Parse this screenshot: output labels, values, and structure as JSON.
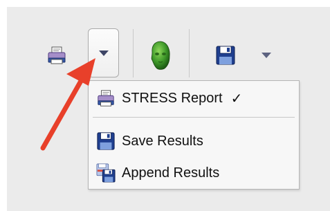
{
  "toolbar": {
    "print_icon": "printer-icon",
    "dropdown_icon": "caret-down-icon",
    "head_icon": "head-3d-icon",
    "save_icon": "floppy-disk-icon",
    "save_dropdown_icon": "caret-down-icon"
  },
  "menu": {
    "items": [
      {
        "label": "STRESS Report",
        "check": "✓",
        "icon": "printer-icon"
      },
      {
        "label": "Save Results",
        "icon": "floppy-disk-icon"
      },
      {
        "label": "Append Results",
        "icon": "append-disk-icon"
      }
    ]
  },
  "annotation": {
    "arrow_color": "#e8402a",
    "points_to": "dropdown-button"
  },
  "colors": {
    "background": "#ebebeb",
    "menu_background": "#f7f7f7",
    "accent_arrow": "#e8402a"
  }
}
